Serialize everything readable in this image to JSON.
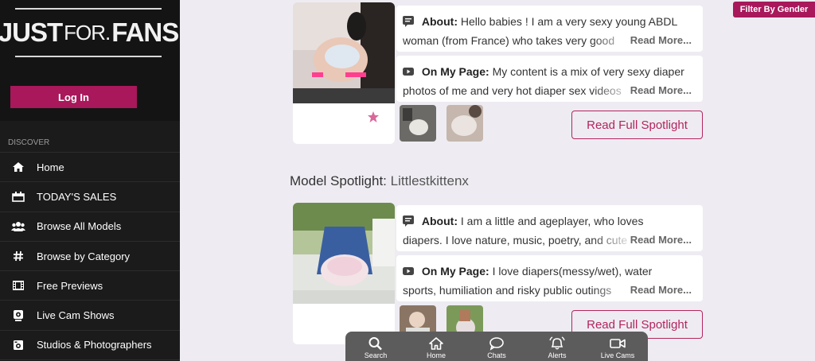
{
  "brand": {
    "logo_left": "JUST",
    "logo_mid": "FOR.",
    "logo_right": "FANS"
  },
  "auth": {
    "login_label": "Log In"
  },
  "filter": {
    "label": "Filter By Gender"
  },
  "sidebar": {
    "section_label": "DISCOVER",
    "items": [
      {
        "label": "Home",
        "icon": "home-icon"
      },
      {
        "label": "TODAY'S SALES",
        "icon": "sales-icon"
      },
      {
        "label": "Browse All Models",
        "icon": "users-icon"
      },
      {
        "label": "Browse by Category",
        "icon": "hashtag-icon"
      },
      {
        "label": "Free Previews",
        "icon": "film-icon"
      },
      {
        "label": "Live Cam Shows",
        "icon": "webcam-icon"
      },
      {
        "label": "Studios & Photographers",
        "icon": "camera-icon"
      }
    ]
  },
  "spotlights": [
    {
      "about_label": "About:",
      "about_line1": "Hello babies ! I am a very sexy young ABDL",
      "about_line2": "woman (from France) who takes very good",
      "page_label": "On My Page:",
      "page_line1": "My content is a mix of very sexy diaper",
      "page_line2": "photos of me and very hot diaper sex videos",
      "read_more": "Read More...",
      "cta": "Read Full Spotlight"
    },
    {
      "title_prefix": "Model Spotlight:",
      "name": "Littlestkittenx",
      "about_label": "About:",
      "about_line1": "I am a little and ageplayer, who loves",
      "about_line2": "diapers. I love nature, music, poetry, and cute",
      "page_label": "On My Page:",
      "page_line1": "I love diapers(messy/wet), water",
      "page_line2": "sports, humiliation and risky public outings",
      "read_more": "Read More...",
      "cta": "Read Full Spotlight"
    }
  ],
  "bottom_nav": [
    {
      "label": "Search",
      "icon": "search-icon"
    },
    {
      "label": "Home",
      "icon": "home-icon"
    },
    {
      "label": "Chats",
      "icon": "chat-icon"
    },
    {
      "label": "Alerts",
      "icon": "bell-icon"
    },
    {
      "label": "Live Cams",
      "icon": "video-icon"
    }
  ],
  "colors": {
    "accent": "#a8185b",
    "sidebar": "#1b1b1b",
    "background": "#eeecf2"
  }
}
